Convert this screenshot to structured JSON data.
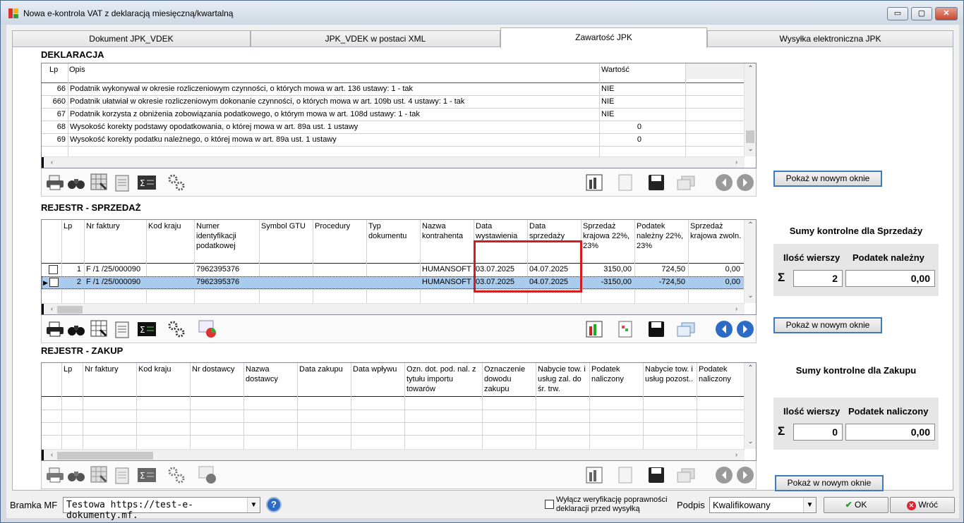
{
  "window": {
    "title": "Nowa e-kontrola VAT z deklaracją miesięczną/kwartalną",
    "buttons": {
      "minimize": "▭",
      "maximize": "▢",
      "close": "✕"
    }
  },
  "tabs": [
    {
      "label": "Dokument  JPK_VDEK"
    },
    {
      "label": "JPK_VDEK w postaci XML"
    },
    {
      "label": "Zawartość JPK"
    },
    {
      "label": "Wysyłka elektroniczna JPK"
    }
  ],
  "deklaracja": {
    "title": "DEKLARACJA",
    "columns": {
      "lp": "Lp",
      "opis": "Opis",
      "wartosc": "Wartość"
    },
    "rows": [
      {
        "lp": "66",
        "opis": "Podatnik wykonywał w okresie rozliczeniowym czynności, o których mowa w art. 136 ustawy: 1 - tak",
        "wartosc": "NIE"
      },
      {
        "lp": "660",
        "opis": "Podatnik ułatwiał w okresie rozliczeniowym dokonanie czynności, o których mowa w art. 109b ust. 4 ustawy: 1 - tak",
        "wartosc": "NIE"
      },
      {
        "lp": "67",
        "opis": "Podatnik korzysta z obniżenia zobowiązania podatkowego, o którym mowa w art. 108d ustawy: 1 - tak",
        "wartosc": "NIE"
      },
      {
        "lp": "68",
        "opis": "Wysokość korekty podstawy opodatkowania, o której mowa w art. 89a ust. 1 ustawy",
        "wartosc": "0"
      },
      {
        "lp": "69",
        "opis": "Wysokość korekty podatku należnego, o której mowa w art. 89a ust. 1 ustawy",
        "wartosc": "0"
      }
    ],
    "show_button": "Pokaż w nowym oknie"
  },
  "sprzedaz": {
    "title": "REJESTR - SPRZEDAŻ",
    "columns": [
      "Lp",
      "Nr faktury",
      "Kod kraju",
      "Numer identyfikacji podatkowej",
      "Symbol GTU",
      "Procedury",
      "Typ dokumentu",
      "Nazwa kontrahenta",
      "Data wystawienia",
      "Data sprzedaży",
      "Sprzedaż krajowa 22%, 23%",
      "Podatek należny 22%, 23%",
      "Sprzedaż krajowa zwoln."
    ],
    "rows": [
      {
        "lp": "1",
        "nr": "F /1  /25/000090",
        "nip": "7962395376",
        "kontrahent": "HUMANSOFT S",
        "data_wyst": "03.07.2025",
        "data_sprz": "04.07.2025",
        "sprzedaz": "3150,00",
        "podatek": "724,50",
        "zwoln": "0,00"
      },
      {
        "lp": "2",
        "nr": "F /1  /25/000090",
        "nip": "7962395376",
        "kontrahent": "HUMANSOFT S",
        "data_wyst": "03.07.2025",
        "data_sprz": "04.07.2025",
        "sprzedaz": "-3150,00",
        "podatek": "-724,50",
        "zwoln": "0,00"
      }
    ],
    "show_button": "Pokaż w nowym oknie",
    "sums": {
      "title": "Sumy kontrolne dla Sprzedaży",
      "col1": "Ilość wierszy",
      "col2": "Podatek należny",
      "sigma": "Σ",
      "count": "2",
      "value": "0,00"
    }
  },
  "zakup": {
    "title": "REJESTR - ZAKUP",
    "columns": [
      "Lp",
      "Nr faktury",
      "Kod kraju",
      "Nr dostawcy",
      "Nazwa dostawcy",
      "Data zakupu",
      "Data wpływu",
      "Ozn. dot. pod. nal. z tytułu importu towarów",
      "Oznaczenie dowodu zakupu",
      "Nabycie tow.  i usług zal. do śr. trw.",
      "Podatek naliczony",
      "Nabycie tow. i usług pozost..",
      "Podatek naliczony"
    ],
    "show_button": "Pokaż w nowym oknie",
    "sums": {
      "title": "Sumy kontrolne dla Zakupu",
      "col1": "Ilość wierszy",
      "col2": "Podatek naliczony",
      "sigma": "Σ",
      "count": "0",
      "value": "0,00"
    }
  },
  "bottom": {
    "bramka_label": "Bramka MF",
    "bramka_value": "Testowa https://test-e-dokumenty.mf.",
    "help": "?",
    "verify_label_1": "Wyłącz weryfikację poprawności",
    "verify_label_2": "deklaracji przed wysyłką",
    "podpis_label": "Podpis",
    "podpis_value": "Kwalifikowany",
    "ok": "OK",
    "back": "Wróć"
  },
  "colors": {
    "selection": "#a9cbee",
    "highlight": "#d11d1d",
    "accent": "#3b7bc2"
  }
}
